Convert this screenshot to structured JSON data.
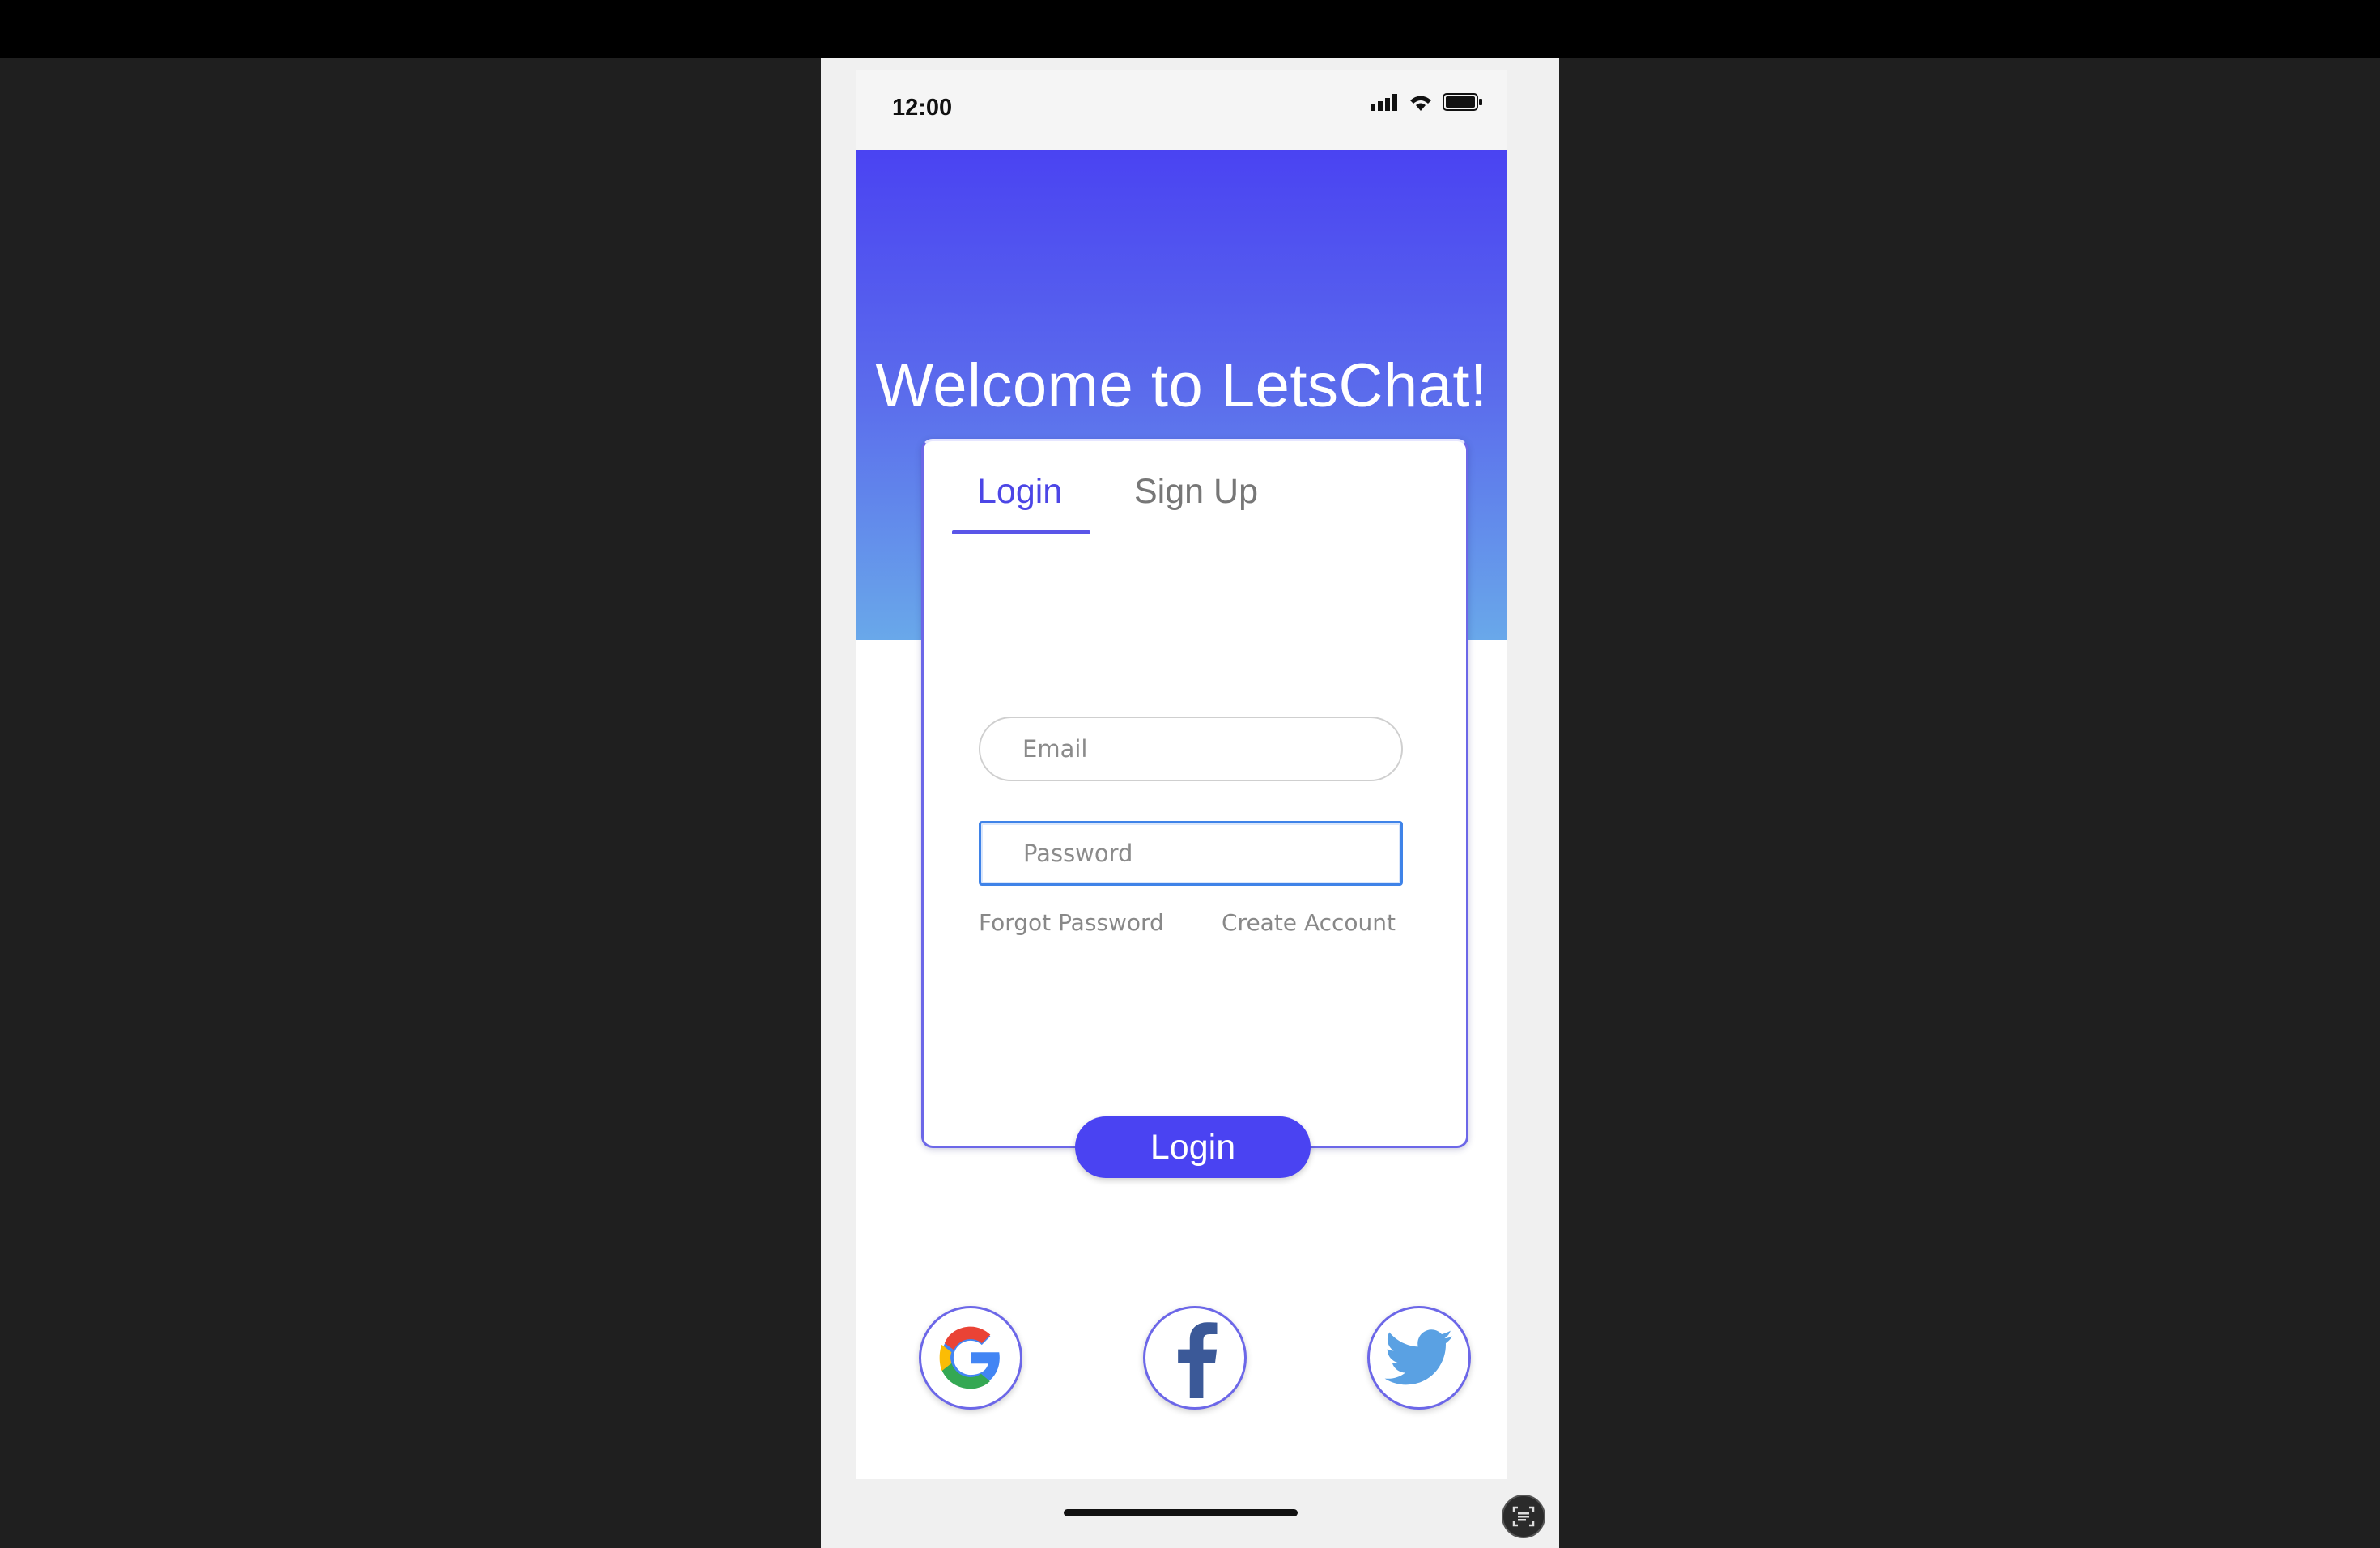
{
  "status_bar": {
    "time": "12:00",
    "icons": [
      "signal-icon",
      "wifi-icon",
      "battery-icon"
    ]
  },
  "hero": {
    "title": "Welcome to LetsChat!"
  },
  "tabs": {
    "login": "Login",
    "signup": "Sign Up",
    "active": "Login"
  },
  "form": {
    "email_placeholder": "Email",
    "email_value": "",
    "password_placeholder": "Password",
    "password_value": ""
  },
  "links": {
    "forgot": "Forgot Password",
    "create": "Create Account"
  },
  "login_button": "Login",
  "social": [
    "google-icon",
    "facebook-icon",
    "twitter-icon"
  ],
  "colors": {
    "accent": "#4a43f2",
    "gradient_top": "#4a43f2",
    "gradient_bottom": "#69a8ea",
    "focus_border": "#3f83e8"
  }
}
